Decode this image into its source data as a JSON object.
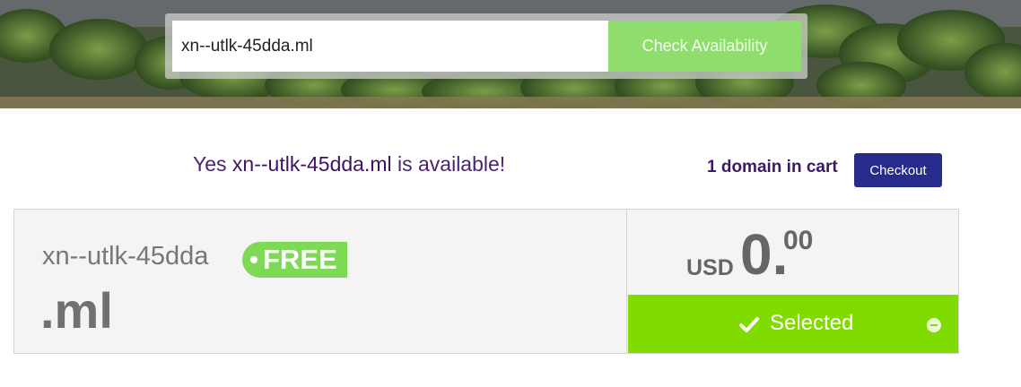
{
  "search": {
    "value": "xn--utlk-45dda.ml",
    "button_label": "Check Availability"
  },
  "availability": {
    "prefix": "Yes",
    "domain": "xn--utlk-45dda.ml",
    "suffix": "is available!"
  },
  "cart": {
    "count_label": "1 domain in cart",
    "checkout_label": "Checkout"
  },
  "result": {
    "sld": "xn--utlk-45dda",
    "tld": ".ml",
    "badge": "FREE",
    "currency": "USD",
    "price_integer": "0.",
    "price_cents": "00",
    "selected_label": "Selected",
    "icons": [
      "check-icon",
      "remove-icon"
    ]
  },
  "colors": {
    "brand_purple": "#3a1a66",
    "checkout_blue": "#262b8c",
    "green_button": "#80db00",
    "light_green": "#8fdd6c"
  }
}
